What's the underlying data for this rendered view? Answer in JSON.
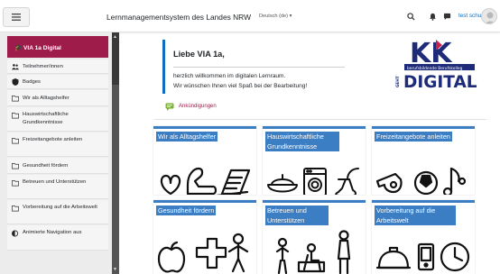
{
  "navbar": {
    "menu_icon": "hamburger-icon",
    "site_title": "Lernmanagementsystem des Landes NRW",
    "language": "Deutsch (de) ▾",
    "icons": [
      "search-icon",
      "bell-icon",
      "chat-icon"
    ],
    "user_name": "test schualer"
  },
  "sidebar": {
    "header": {
      "label": "VIA 1a Digital",
      "icon": "graduation-cap-icon",
      "color": "#9d1c4a"
    },
    "items": [
      {
        "label": "Teilnehmer/innen",
        "icon": "users-icon"
      },
      {
        "label": "Badges",
        "icon": "shield-icon"
      },
      {
        "label": "Wir als Alltagshelfer",
        "icon": "folder-icon"
      },
      {
        "label": "Hauswirtschaftliche Grundkenntnisse",
        "icon": "folder-icon"
      },
      {
        "label": "Freizeitangebote anleiten",
        "icon": "folder-icon"
      },
      {
        "label": "Gesundheit fördern",
        "icon": "folder-icon"
      },
      {
        "label": "Betreuen und Unterstützen",
        "icon": "folder-icon"
      },
      {
        "label": "Vorbereitung auf die Arbeitswelt",
        "icon": "folder-icon"
      },
      {
        "label": "Animierte Navigation aus",
        "icon": "toggle-icon"
      }
    ]
  },
  "welcome": {
    "title": "Liebe VIA 1a,",
    "line1": "herzlich willkommen im digitalen Lernraum.",
    "line2": "Wir wünschen Ihnen viel Spaß bei der Bearbeitung!"
  },
  "logo": {
    "big_text": "KK",
    "sub_text": "berufsbildende Berufskolleg",
    "digital": "DIGITAL",
    "side_text": "GEHT"
  },
  "announcements": {
    "label": "Ankündigungen",
    "icon": "megaphone-icon"
  },
  "tiles": [
    {
      "label": "Wir als Alltagshelfer"
    },
    {
      "label": "Hauswirtschaftliche Grundkenntnisse"
    },
    {
      "label": "Freizeitangebote anleiten"
    },
    {
      "label": "Gesundheit fördern"
    },
    {
      "label": "Betreuen und Unterstützen"
    },
    {
      "label": "Vorbereitung auf die Arbeitswelt"
    }
  ],
  "colors": {
    "accent": "#9d1c4a",
    "tile_blue": "#3c7ec3",
    "link": "#0f6cbf",
    "logo_navy": "#1d2b79"
  }
}
